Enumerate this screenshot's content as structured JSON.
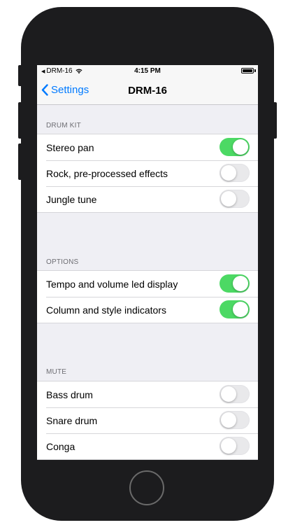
{
  "status": {
    "carrier": "DRM-16",
    "time": "4:15 PM",
    "back_glyph": "◀"
  },
  "nav": {
    "back_label": "Settings",
    "title": "DRM-16"
  },
  "sections": [
    {
      "header": "DRUM KIT",
      "rows": [
        {
          "label": "Stereo pan",
          "on": true
        },
        {
          "label": "Rock, pre-processed effects",
          "on": false
        },
        {
          "label": "Jungle tune",
          "on": false
        }
      ]
    },
    {
      "header": "OPTIONS",
      "rows": [
        {
          "label": "Tempo and volume led display",
          "on": true
        },
        {
          "label": "Column and style indicators",
          "on": true
        }
      ]
    },
    {
      "header": "MUTE",
      "rows": [
        {
          "label": "Bass drum",
          "on": false
        },
        {
          "label": "Snare drum",
          "on": false
        },
        {
          "label": "Conga",
          "on": false
        }
      ]
    }
  ],
  "colors": {
    "accent": "#007aff",
    "toggle_on": "#4cd964",
    "background": "#efeff4"
  }
}
